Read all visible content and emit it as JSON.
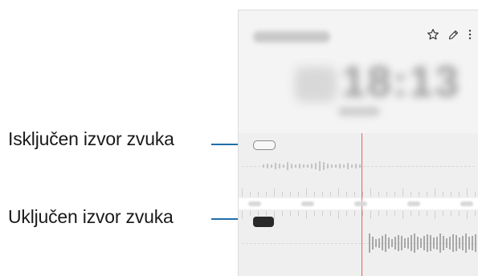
{
  "callouts": {
    "source_off_label": "Isključen izvor zvuka",
    "source_on_label": "Uključen izvor zvuka"
  },
  "toolbar": {
    "icons": [
      "star-icon",
      "pencil-icon",
      "more-vertical-icon"
    ]
  },
  "player": {
    "time_display": "18:13"
  },
  "colors": {
    "leader_line": "#1f6fa8",
    "playhead": "#e0645e",
    "source_on": "#2a2a2a"
  }
}
